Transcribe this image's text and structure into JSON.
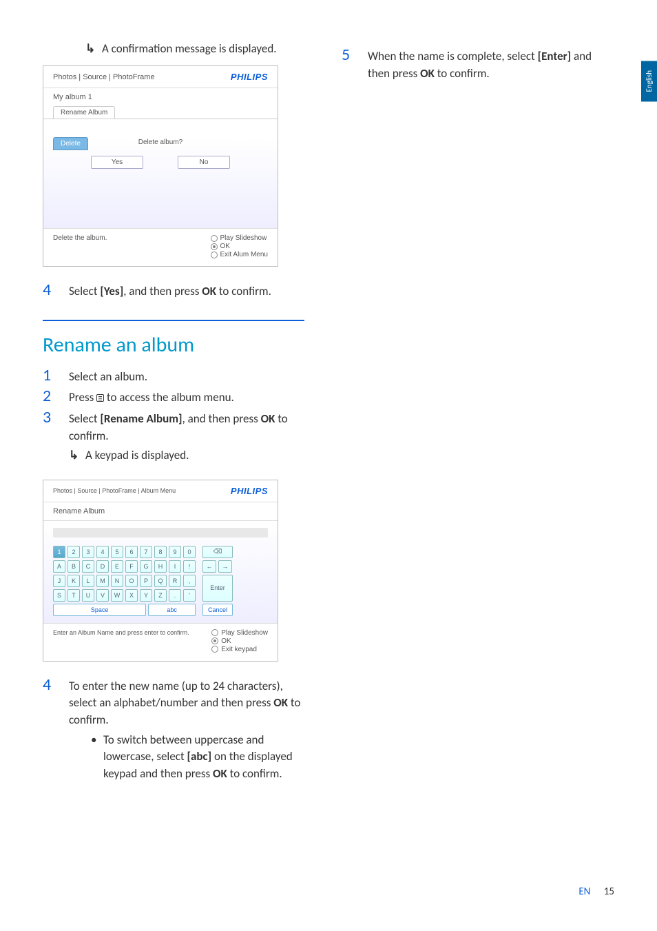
{
  "sideTab": "English",
  "col1": {
    "prebullet": "A confirmation message is displayed.",
    "ss1": {
      "breadcrumb": "Photos | Source | PhotoFrame",
      "brand": "PHILIPS",
      "row1": "My album 1",
      "tab_rename": "Rename Album",
      "tab_delete": "Delete",
      "dialog_q": "Delete album?",
      "yes": "Yes",
      "no": "No",
      "foot_left": "Delete the album.",
      "foot_r1": "Play Slideshow",
      "foot_r2": "OK",
      "foot_r3": "Exit Alum Menu"
    },
    "step4": {
      "num": "4",
      "t1": "Select ",
      "b1": "[Yes]",
      "t2": ", and then press ",
      "b2": "OK",
      "t3": " to confirm."
    },
    "section": "Rename an album",
    "step1": {
      "num": "1",
      "text": "Select an album."
    },
    "step2": {
      "num": "2",
      "t1": "Press ",
      "t2": " to access the album menu."
    },
    "step3": {
      "num": "3",
      "t1": "Select ",
      "b1": "[Rename Album]",
      "t2": ", and then press ",
      "b2": "OK",
      "t3": " to confirm."
    },
    "step3_bullet": "A keypad is displayed.",
    "ss2": {
      "breadcrumb": "Photos | Source | PhotoFrame | Album Menu",
      "brand": "PHILIPS",
      "tab": "Rename Album",
      "row1": [
        "1",
        "2",
        "3",
        "4",
        "5",
        "6",
        "7",
        "8",
        "9",
        "0"
      ],
      "row2": [
        "A",
        "B",
        "C",
        "D",
        "E",
        "F",
        "G",
        "H",
        "I",
        "!"
      ],
      "row3": [
        "J",
        "K",
        "L",
        "M",
        "N",
        "O",
        "P",
        "Q",
        "R",
        ","
      ],
      "row4": [
        "S",
        "T",
        "U",
        "V",
        "W",
        "X",
        "Y",
        "Z",
        ".",
        "'"
      ],
      "backspace": "⌫",
      "enter": "Enter",
      "space": "Space",
      "abc": "abc",
      "cancel": "Cancel",
      "foot_left": "Enter an Album Name and press enter to confirm.",
      "foot_r1": "Play Slideshow",
      "foot_r2": "OK",
      "foot_r3": "Exit keypad"
    },
    "step4b": {
      "num": "4",
      "t1": "To enter the new name (up to 24 characters), select an alphabet/number and then press ",
      "b1": "OK",
      "t2": " to confirm."
    },
    "step4b_sub": {
      "t1": "To switch between uppercase and lowercase, select ",
      "b1": "[abc]",
      "t2": " on the displayed keypad and then press ",
      "b2": "OK",
      "t3": " to confirm."
    }
  },
  "col2": {
    "step5": {
      "num": "5",
      "t1": "When the name is complete, select ",
      "b1": "[Enter]",
      "t2": " and then press ",
      "b2": "OK",
      "t3": " to confirm."
    }
  },
  "footer": {
    "lang": "EN",
    "page": "15"
  }
}
